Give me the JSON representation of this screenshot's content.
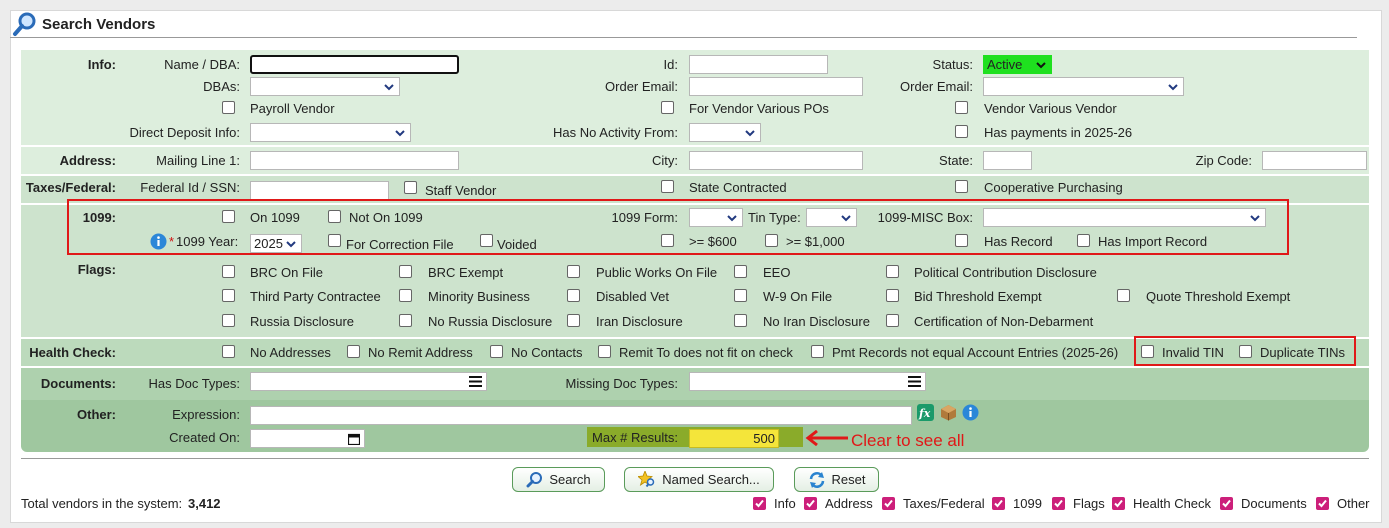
{
  "title": "Search Vendors",
  "info": {
    "section": "Info:",
    "name_label": "Name / DBA:",
    "id_label": "Id:",
    "status_label": "Status:",
    "status_value": "Active",
    "dbas_label": "DBAs:",
    "order_email_label": "Order Email:",
    "order_email2_label": "Order Email:",
    "payroll_vendor": "Payroll Vendor",
    "for_vendor_various_pos": "For Vendor Various POs",
    "vendor_various_vendor": "Vendor Various Vendor",
    "direct_deposit_label": "Direct Deposit Info:",
    "no_activity_label": "Has No Activity From:",
    "has_payments": "Has payments in 2025-26"
  },
  "address": {
    "section": "Address:",
    "mailing_label": "Mailing Line 1:",
    "city_label": "City:",
    "state_label": "State:",
    "zip_label": "Zip Code:"
  },
  "taxes": {
    "section": "Taxes/Federal:",
    "fedid_label": "Federal Id / SSN:",
    "staff_vendor": "Staff Vendor",
    "state_contracted": "State Contracted",
    "coop_purchasing": "Cooperative Purchasing"
  },
  "f1099": {
    "section": "1099:",
    "on_1099": "On 1099",
    "not_on_1099": "Not On 1099",
    "form_label": "1099 Form:",
    "tin_type_label": "Tin Type:",
    "misc_box_label": "1099-MISC Box:",
    "year_required": "*",
    "year_label": "1099 Year:",
    "year_value": "2025",
    "for_correction": "For Correction File",
    "voided": "Voided",
    "gte_600": ">= $600",
    "gte_1000": ">= $1,000",
    "has_record": "Has Record",
    "has_import_record": "Has Import Record"
  },
  "flags": {
    "section": "Flags:",
    "items": [
      "BRC On File",
      "BRC Exempt",
      "Public Works On File",
      "EEO",
      "Political Contribution Disclosure",
      "Third Party Contractee",
      "Minority Business",
      "Disabled Vet",
      "W-9 On File",
      "Bid Threshold Exempt",
      "Quote Threshold Exempt",
      "Russia Disclosure",
      "No Russia Disclosure",
      "Iran Disclosure",
      "No Iran Disclosure",
      "Certification of Non-Debarment"
    ]
  },
  "health": {
    "section": "Health Check:",
    "items": [
      "No Addresses",
      "No Remit Address",
      "No Contacts",
      "Remit To does not fit on check",
      "Pmt Records not equal Account Entries (2025-26)",
      "Invalid TIN",
      "Duplicate TINs"
    ]
  },
  "documents": {
    "section": "Documents:",
    "has_doc_types_label": "Has Doc Types:",
    "missing_doc_types_label": "Missing Doc Types:"
  },
  "other": {
    "section": "Other:",
    "expression_label": "Expression:",
    "created_on_label": "Created On:",
    "max_results_label": "Max # Results:",
    "max_results_value": "500",
    "annotation": "Clear to see all"
  },
  "buttons": {
    "search": "Search",
    "named_search": "Named Search...",
    "reset": "Reset"
  },
  "footer": {
    "total_label": "Total vendors in the system:",
    "total_value": "3,412",
    "toggles": [
      "Info",
      "Address",
      "Taxes/Federal",
      "1099",
      "Flags",
      "Health Check",
      "Documents",
      "Other"
    ]
  },
  "icons": {
    "title": "magnifier-icon",
    "fx": "function-icon",
    "box": "package-icon",
    "info": "info-icon",
    "calendar": "calendar-icon",
    "menu": "menu-icon",
    "arrow": "red-arrow-icon"
  },
  "colors": {
    "row_light": "#ddeedd",
    "row_mid": "#cde3cd",
    "row_dark": "#aed1ae",
    "row_darker": "#9fc79f",
    "status_green": "#1fe01f",
    "annotation_red": "#e01818",
    "checked_magenta": "#cc1f7a"
  }
}
